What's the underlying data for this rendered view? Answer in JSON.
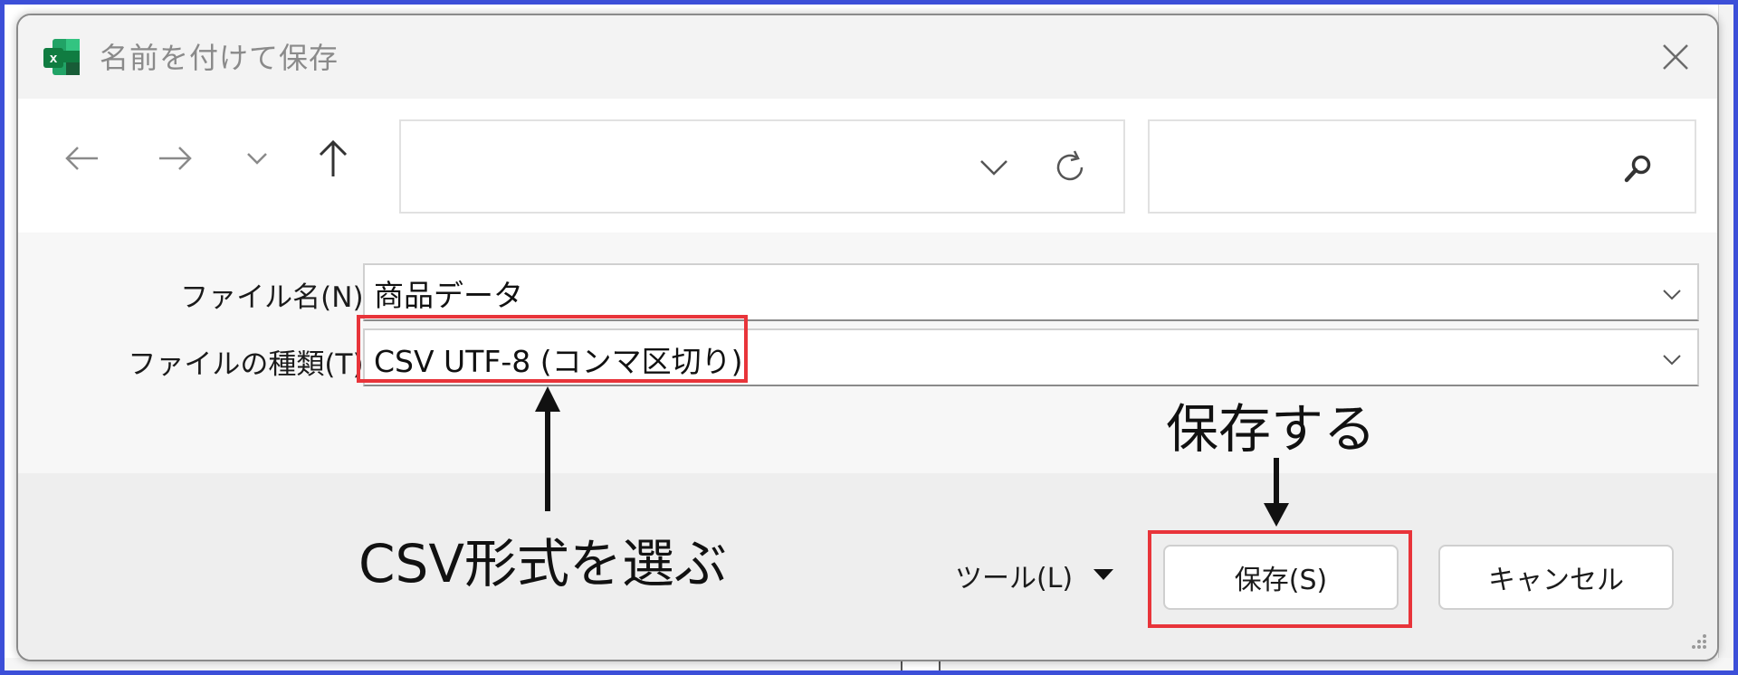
{
  "dialog": {
    "title": "名前を付けて保存",
    "close_icon": "close-icon",
    "app_icon": "excel-icon"
  },
  "nav": {
    "back_icon": "arrow-left-icon",
    "forward_icon": "arrow-right-icon",
    "recent_icon": "chevron-down-icon",
    "up_icon": "arrow-up-icon",
    "address_value": "",
    "search_value": "",
    "refresh_icon": "refresh-icon",
    "search_icon": "search-icon"
  },
  "form": {
    "filename_label": "ファイル名(N):",
    "filename_value": "商品データ",
    "filetype_label": "ファイルの種類(T):",
    "filetype_value": "CSV UTF-8 (コンマ区切り)"
  },
  "footer": {
    "tools_label": "ツール(L)",
    "save_label": "保存(S)",
    "cancel_label": "キャンセル"
  },
  "annotations": {
    "choose_csv": "CSV形式を選ぶ",
    "save": "保存する",
    "highlight_color": "#e8343a"
  }
}
